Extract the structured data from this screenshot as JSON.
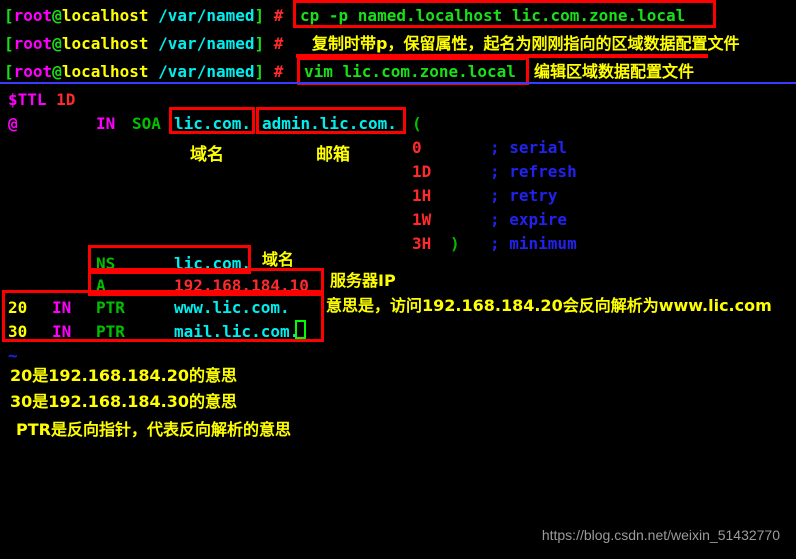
{
  "window": {
    "title": "root@localhost:/var/named",
    "background": "#000000",
    "watermark": "https://blog.csdn.net/weixin_51432770"
  },
  "prompt": {
    "open_bracket": "[",
    "user": "root",
    "at": "@",
    "host": "localhost",
    "path": "/var/named",
    "close_bracket": "]",
    "hash": "#"
  },
  "shell_lines": [
    {
      "command": "cp -p named.localhost lic.com.zone.local",
      "annotation": "",
      "boxed": true
    },
    {
      "command": "",
      "annotation": "复制时带p，保留属性，起名为刚刚指向的区域数据配置文件",
      "boxed": false
    },
    {
      "command": "vim lic.com.zone.local",
      "annotation": "编辑区域数据配置文件",
      "boxed": true
    }
  ],
  "zone_file": {
    "ttl_directive": "$TTL",
    "ttl_value": "1D",
    "soa": {
      "origin": "@",
      "class": "IN",
      "type": "SOA",
      "primary_ns": "lic.com.",
      "rp_email": "admin.lic.com.",
      "open_paren": "(",
      "close_paren": ")",
      "label_domain": "域名",
      "label_email": "邮箱",
      "timers": [
        {
          "value": "0",
          "comment": "; serial"
        },
        {
          "value": "1D",
          "comment": "; refresh"
        },
        {
          "value": "1H",
          "comment": "; retry"
        },
        {
          "value": "1W",
          "comment": "; expire"
        },
        {
          "value": "3H",
          "comment": "; minimum"
        }
      ]
    },
    "records": [
      {
        "name": "",
        "class": "",
        "type": "NS",
        "value": "lic.com.",
        "label": "域名"
      },
      {
        "name": "",
        "class": "",
        "type": "A",
        "value": "192.168.184.10",
        "label": "服务器IP"
      },
      {
        "name": "20",
        "class": "IN",
        "type": "PTR",
        "value": "www.lic.com.",
        "label": ""
      },
      {
        "name": "30",
        "class": "IN",
        "type": "PTR",
        "value": "mail.lic.com.",
        "label": ""
      }
    ],
    "empty_line_marker": "~"
  },
  "annotations": {
    "ptr_explanation": "意思是，访问192.168.184.20会反向解析为www.lic.com",
    "notes": [
      "20是192.168.184.20的意思",
      "30是192.168.184.30的意思",
      "PTR是反向指针，代表反向解析的意思"
    ]
  },
  "colors": {
    "background": "#000000",
    "highlight_box": "#ff0000",
    "annotation_text": "#ffff00",
    "command_text": "#18e018",
    "cursor": "#00ff00",
    "comment": "#2222ee"
  }
}
